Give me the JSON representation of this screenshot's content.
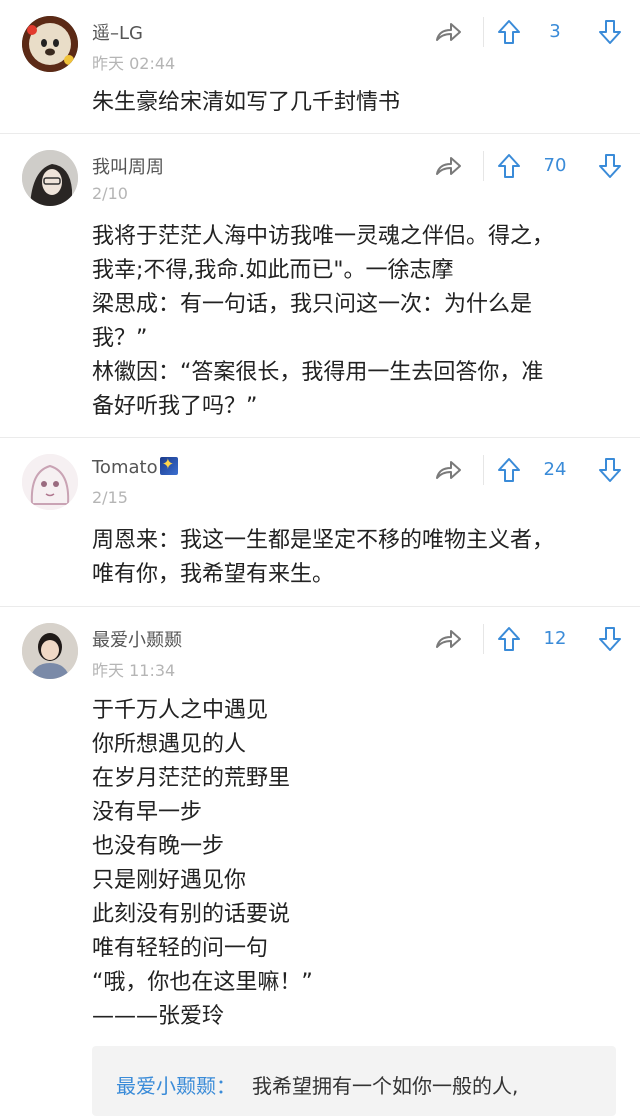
{
  "comments": [
    {
      "username": "遥–LG",
      "time": "昨天 02:44",
      "likes": "3",
      "body": "朱生豪给宋清如写了几千封情书"
    },
    {
      "username": "我叫周周",
      "time": "2/10",
      "likes": "70",
      "body": "我将于茫茫人海中访我唯一灵魂之伴侣。得之，\n我幸;不得,我命.如此而已\"。一徐志摩\n梁思成：有一句话，我只问这一次：为什么是\n我？”\n林徽因：“答案很长，我得用一生去回答你，准\n备好听我了吗？”"
    },
    {
      "username": "Tomato",
      "time": "2/15",
      "likes": "24",
      "body": "周恩来：我这一生都是坚定不移的唯物主义者，\n唯有你，我希望有来生。"
    },
    {
      "username": "最爱小颞颞",
      "time": "昨天 11:34",
      "likes": "12",
      "body": "于千万人之中遇见\n你所想遇见的人\n在岁月茫茫的荒野里\n没有早一步\n也没有晚一步\n只是刚好遇见你\n此刻没有别的话要说\n唯有轻轻的问一句\n“哦，你也在这里嘛！”\n            ———张爱玲"
    }
  ],
  "reply": {
    "name": "最爱小颞颞：",
    "text": "我希望拥有一个如你一般的人,"
  },
  "icons": {
    "share": "share-arrow-icon",
    "upvote": "upvote-arrow-icon",
    "downvote": "downvote-arrow-icon"
  },
  "colors": {
    "accent": "#3a8bd8",
    "text": "#222222",
    "muted": "#b5b5b5"
  }
}
